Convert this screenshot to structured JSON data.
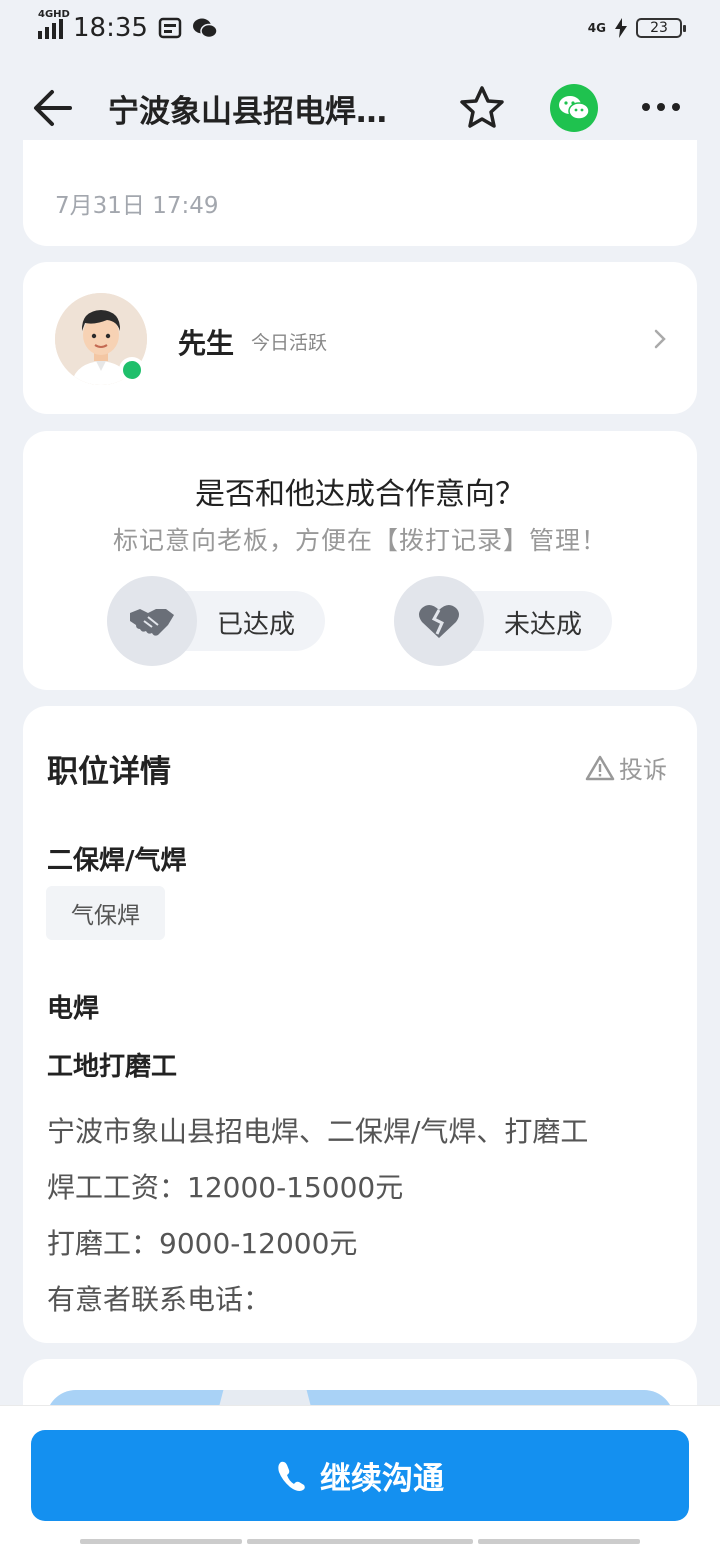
{
  "status": {
    "network_tag": "4GHD",
    "time": "18:35",
    "right_tag": "4G",
    "battery": "23"
  },
  "nav": {
    "title": "宁波象山县招电焊…"
  },
  "post": {
    "date": "7月31日 17:49"
  },
  "boss": {
    "name": "先生",
    "active": "今日活跃"
  },
  "intent": {
    "question": "是否和他达成合作意向？",
    "subtitle": "标记意向老板，方便在【拨打记录】管理！",
    "yes_label": "已达成",
    "no_label": "未达成"
  },
  "detail": {
    "title": "职位详情",
    "report_label": "投诉",
    "category_1": "二保焊/气焊",
    "tag_1": "气保焊",
    "category_2": "电焊",
    "category_3": "工地打磨工",
    "desc_lines": [
      "宁波市象山县招电焊、二保焊/气焊、打磨工",
      "焊工工资：12000-15000元",
      "打磨工：9000-12000元",
      "有意者联系电话："
    ]
  },
  "cta": {
    "label": "继续沟通"
  },
  "colors": {
    "primary": "#1490f0",
    "wechat": "#1fc24f",
    "online": "#1fbf6b",
    "background": "#eef1f6"
  }
}
